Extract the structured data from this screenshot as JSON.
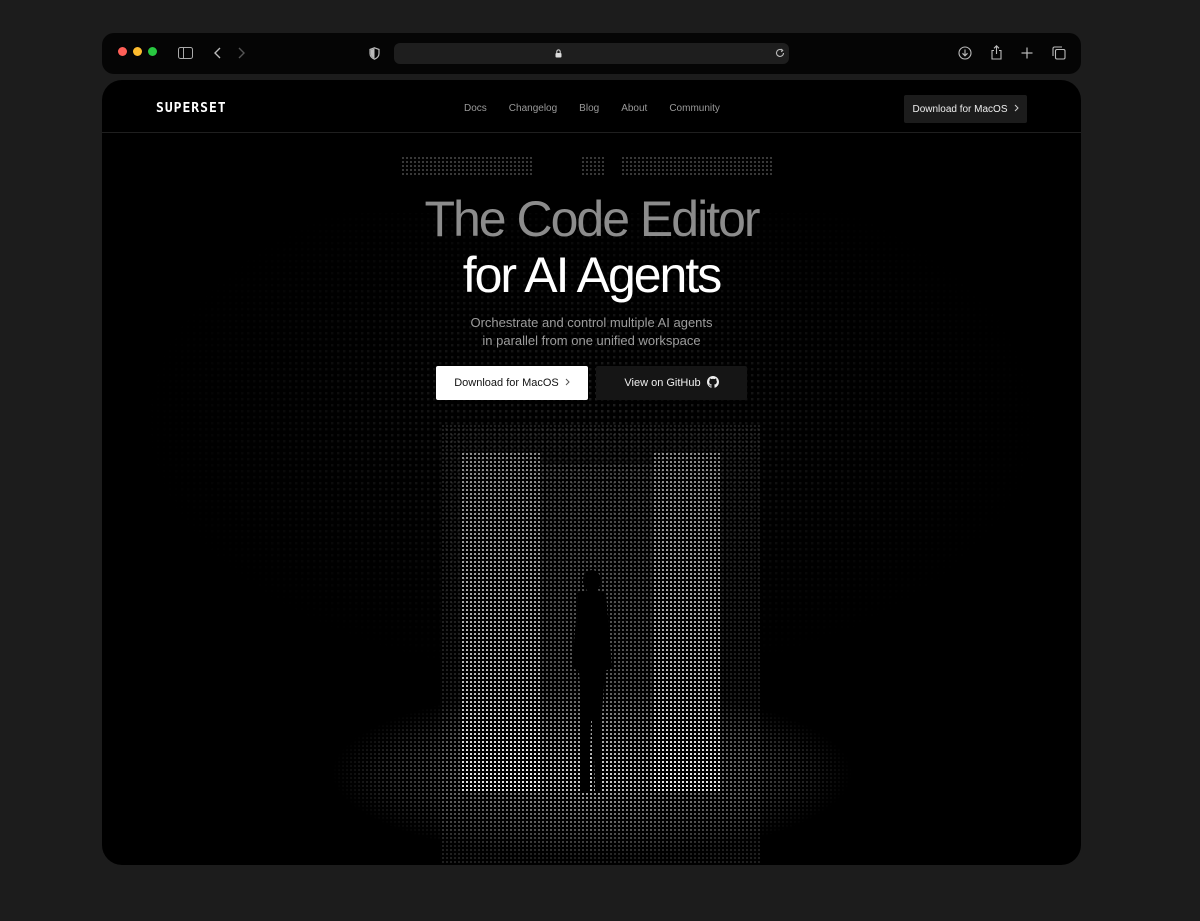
{
  "browser": {
    "traffic_colors": {
      "close": "#ff5f57",
      "minimize": "#febc2e",
      "maximize": "#28c840"
    },
    "icons": [
      "sidebar-icon",
      "back-icon",
      "forward-icon",
      "shield-icon",
      "lock-icon",
      "reload-icon",
      "download-icon",
      "share-icon",
      "new-tab-icon",
      "tabs-overview-icon"
    ]
  },
  "site": {
    "logo": "SUPERSET",
    "nav": {
      "links": [
        "Docs",
        "Changelog",
        "Blog",
        "About",
        "Community"
      ],
      "download_label": "Download for MacOS"
    },
    "hero": {
      "title_line1": "The Code Editor",
      "title_line2": "for AI Agents",
      "subtitle_line1": "Orchestrate and control multiple AI agents",
      "subtitle_line2": "in parallel from one unified workspace",
      "primary_button": "Download for MacOS",
      "secondary_button": "View on GitHub"
    }
  },
  "colors": {
    "accent": "#ffffff",
    "background": "#000000",
    "muted_text": "#9c9c9c"
  }
}
